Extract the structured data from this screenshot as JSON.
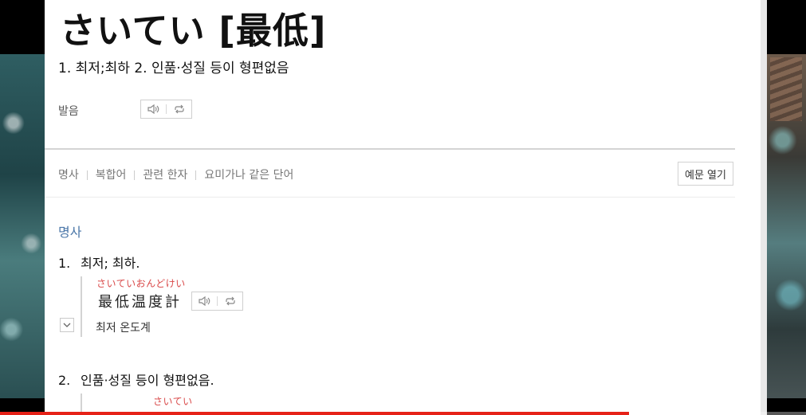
{
  "entry": {
    "headword": "さいてい [最低]",
    "summary": "1. 최저;최하 2. 인품·성질 등이 형편없음"
  },
  "pronunciation": {
    "label": "발음",
    "play_icon": "speaker-icon",
    "repeat_icon": "repeat-icon"
  },
  "tabs": [
    "명사",
    "복합어",
    "관련 한자",
    "요미가나 같은 단어"
  ],
  "example_button": "예문 열기",
  "part_of_speech": "명사",
  "senses": [
    {
      "number": "1.",
      "text": "최저; 최하.",
      "example": {
        "furigana": "さいていおんどけい",
        "kanji": "最低温度計",
        "meaning": "최저 온도계"
      }
    },
    {
      "number": "2.",
      "text": "인품·성질 등이 형편없음.",
      "example": {
        "furigana": "さいてい"
      }
    }
  ],
  "player": {
    "progress": 0.78,
    "progress_color": "#e62117"
  }
}
